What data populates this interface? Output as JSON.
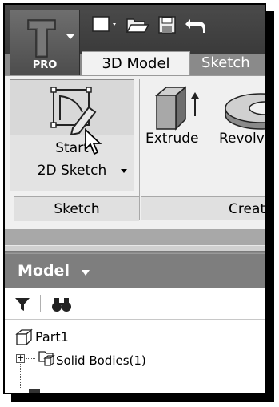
{
  "app_menu": {
    "badge": "PRO",
    "icon": "inventor-logo-icon"
  },
  "quick_access": {
    "items": [
      {
        "name": "new-icon"
      },
      {
        "name": "open-icon"
      },
      {
        "name": "save-icon"
      },
      {
        "name": "undo-icon"
      }
    ]
  },
  "tabs": [
    {
      "label": "3D Model",
      "active": true
    },
    {
      "label": "Sketch",
      "active": false
    }
  ],
  "ribbon": {
    "start_sketch": {
      "line1": "Start",
      "line2": "2D Sketch",
      "icon": "start-2d-sketch-icon"
    },
    "sketch_panel_label": "Sketch",
    "extrude_label": "Extrude",
    "revolve_label": "Revolv",
    "create_panel_label": "Creat"
  },
  "browser": {
    "title": "Model",
    "tree": [
      {
        "label": "Part1",
        "icon": "part-icon"
      },
      {
        "label": "Solid Bodies(1)",
        "icon": "solid-bodies-icon"
      }
    ]
  },
  "colors": {
    "ribbon_bg": "#f0f0f0",
    "header_bg": "#7e7e7e",
    "quick_access_bg": "#404040"
  }
}
